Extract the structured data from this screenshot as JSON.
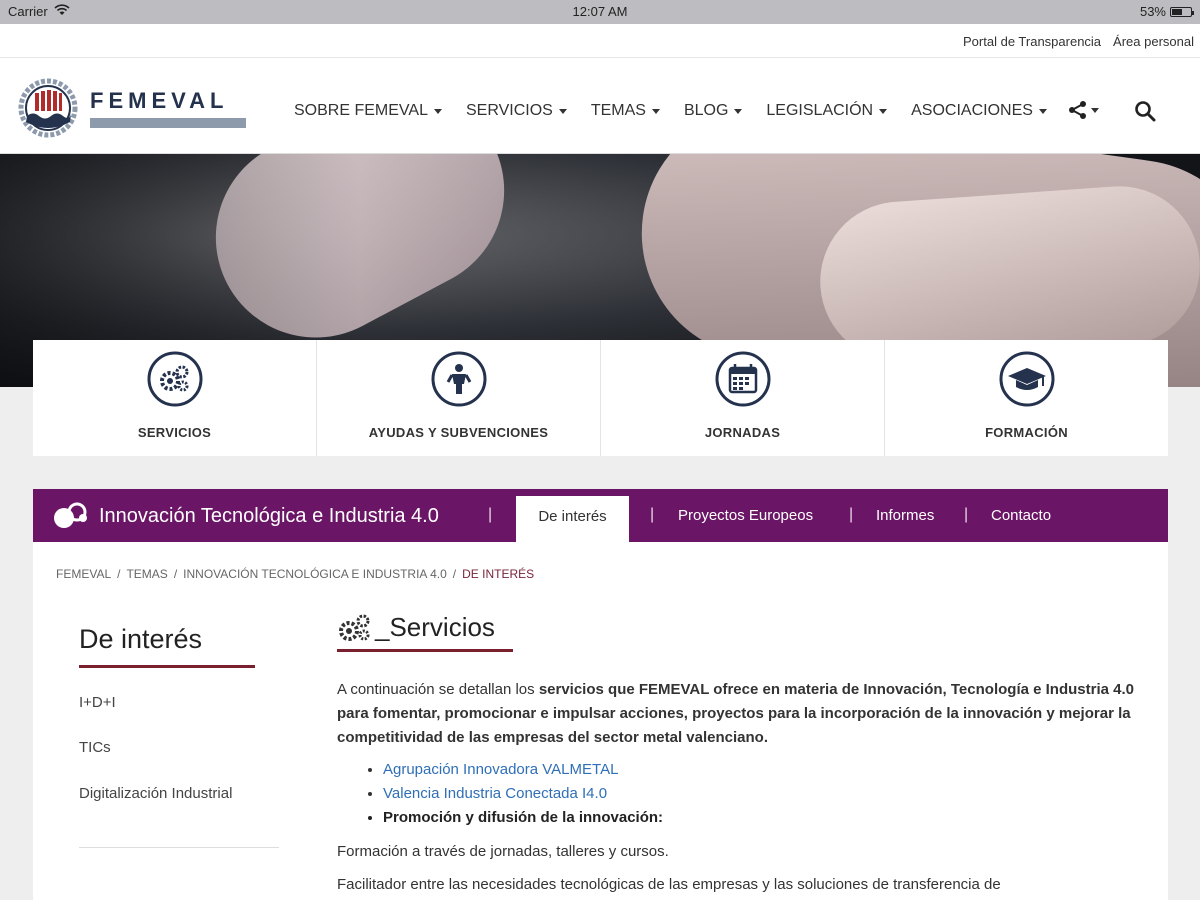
{
  "status_bar": {
    "carrier": "Carrier",
    "time": "12:07 AM",
    "battery": "53%",
    "battery_level": 0.53
  },
  "util_links": [
    "Portal de Transparencia",
    "Área personal"
  ],
  "logo": {
    "wordmark": "FEMEVAL"
  },
  "nav": {
    "items": [
      "SOBRE FEMEVAL",
      "SERVICIOS",
      "TEMAS",
      "BLOG",
      "LEGISLACIÓN",
      "ASOCIACIONES"
    ],
    "share_icon": "share-icon",
    "search_icon": "search-icon"
  },
  "cards": [
    {
      "label": "SERVICIOS",
      "icon": "gears-icon"
    },
    {
      "label": "AYUDAS Y SUBVENCIONES",
      "icon": "person-icon"
    },
    {
      "label": "JORNADAS",
      "icon": "calendar-icon"
    },
    {
      "label": "FORMACIÓN",
      "icon": "graduation-cap-icon"
    }
  ],
  "section": {
    "title": "Innovación Tecnológica e Industria 4.0",
    "tabs": [
      "De interés",
      "Proyectos Europeos",
      "Informes",
      "Contacto"
    ],
    "active_tab": "De interés",
    "color": "#6b1566"
  },
  "breadcrumb": [
    "FEMEVAL",
    "TEMAS",
    "INNOVACIÓN TECNOLÓGICA E INDUSTRIA 4.0",
    "DE INTERÉS"
  ],
  "sidebar": {
    "title": "De interés",
    "links": [
      "I+D+I",
      "TICs",
      "Digitalización Industrial"
    ]
  },
  "content": {
    "heading": "_Servicios",
    "intro_plain": "A continuación se detallan los ",
    "intro_bold": "servicios que FEMEVAL ofrece en materia de Innovación, Tecnología e Industria 4.0 para fomentar, promocionar e impulsar acciones, proyectos para la incorporación de la innovación y mejorar la competitividad de las empresas del sector metal valenciano.",
    "links": [
      "Agrupación Innovadora VALMETAL",
      "Valencia Industria Conectada I4.0"
    ],
    "bold_item": "Promoción y difusión de la innovación:",
    "paragraphs": [
      "Formación a través de jornadas, talleres y cursos.",
      "Facilitador entre las necesidades tecnológicas de las empresas y las soluciones de transferencia de"
    ]
  },
  "colors": {
    "brand_navy": "#24324e",
    "accent_red": "#7a1f2e",
    "link_blue": "#2f6fb7"
  }
}
